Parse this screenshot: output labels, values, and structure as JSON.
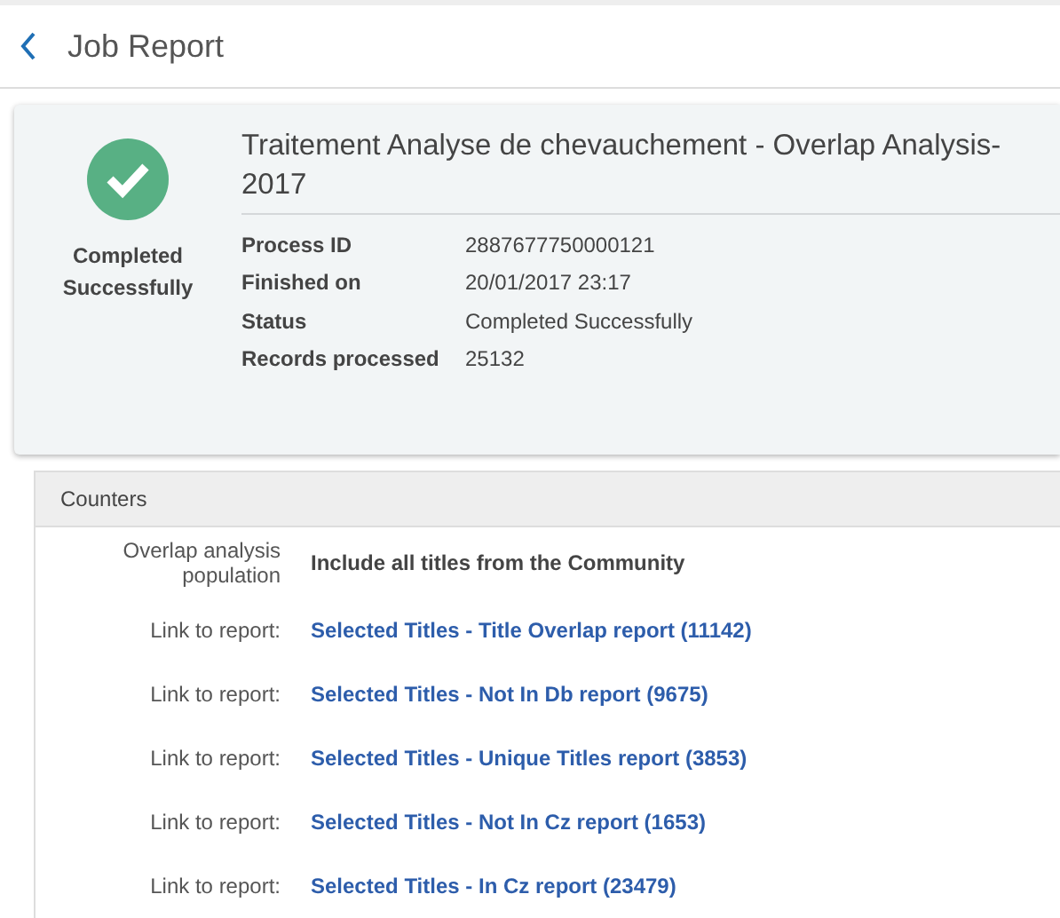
{
  "header": {
    "title": "Job Report"
  },
  "job": {
    "succeeded": true,
    "status_label": "Completed Successfully",
    "title_lines": [
      "Traitement Analyse de chevauchement - Overlap Analysis-",
      "2017"
    ],
    "details": [
      {
        "label": "Process ID",
        "value": "2887677750000121"
      },
      {
        "label": "Finished on",
        "value": "20/01/2017 23:17"
      },
      {
        "label": "Status",
        "value": "Completed Successfully"
      },
      {
        "label": "Records processed",
        "value": "25132"
      }
    ]
  },
  "counters": {
    "title": "Counters",
    "rows": [
      {
        "kind": "text",
        "label": "Overlap analysis population",
        "value": "Include all titles from the Community"
      },
      {
        "kind": "link",
        "label": "Link to report:",
        "value": "Selected Titles - Title Overlap report (11142)"
      },
      {
        "kind": "link",
        "label": "Link to report:",
        "value": "Selected Titles - Not In Db report (9675)"
      },
      {
        "kind": "link",
        "label": "Link to report:",
        "value": "Selected Titles - Unique Titles report (3853)"
      },
      {
        "kind": "link",
        "label": "Link to report:",
        "value": "Selected Titles - Not In Cz report (1653)"
      },
      {
        "kind": "link",
        "label": "Link to report:",
        "value": "Selected Titles - In Cz report (23479)"
      }
    ]
  }
}
